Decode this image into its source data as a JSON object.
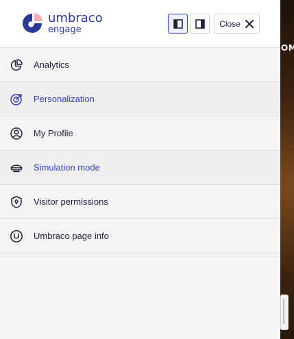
{
  "brand": {
    "name": "umbraco",
    "product": "engage"
  },
  "header": {
    "close_label": "Close",
    "layout_left_icon": "dock-left-icon",
    "layout_right_icon": "dock-right-icon"
  },
  "menu": [
    {
      "label": "Analytics",
      "icon": "pie-chart-icon",
      "active": false
    },
    {
      "label": "Personalization",
      "icon": "target-icon",
      "active": true
    },
    {
      "label": "My Profile",
      "icon": "user-circle-icon",
      "active": false
    },
    {
      "label": "Simulation mode",
      "icon": "visor-cap-icon",
      "active": false
    },
    {
      "label": "Visitor permissions",
      "icon": "shield-lock-icon",
      "active": false
    },
    {
      "label": "Umbraco page info",
      "icon": "umbraco-u-icon",
      "active": false
    }
  ],
  "background": {
    "visible_text": "OM"
  },
  "colors": {
    "accent": "#283a97",
    "active_label": "#3544b1",
    "panel_bg": "#f5f3f3"
  }
}
